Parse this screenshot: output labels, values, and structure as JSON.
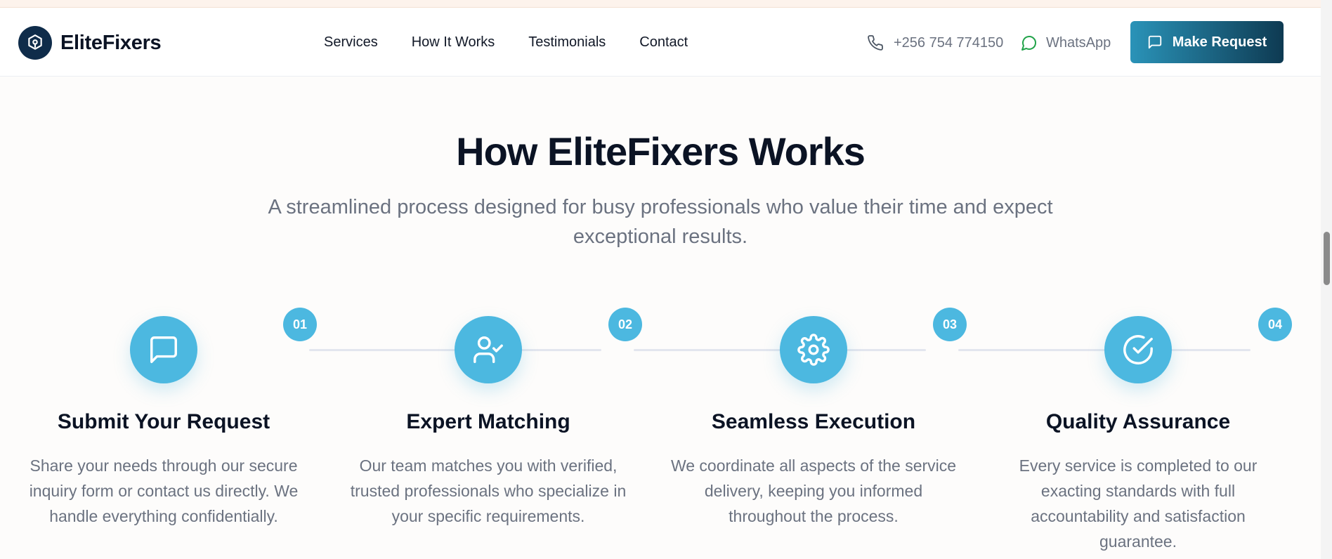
{
  "brand": {
    "name": "EliteFixers"
  },
  "nav": {
    "items": [
      "Services",
      "How It Works",
      "Testimonials",
      "Contact"
    ]
  },
  "contact": {
    "phone": "+256 754 774150",
    "whatsapp": "WhatsApp"
  },
  "cta": {
    "label": "Make Request"
  },
  "section": {
    "title": "How EliteFixers Works",
    "subtitle_line1": "A streamlined process designed for busy professionals who value their time and expect",
    "subtitle_line2": "exceptional results."
  },
  "steps": [
    {
      "number": "01",
      "icon": "message-square-icon",
      "title": "Submit Your Request",
      "description": "Share your needs through our secure inquiry form or contact us directly. We handle everything confidentially."
    },
    {
      "number": "02",
      "icon": "user-check-icon",
      "title": "Expert Matching",
      "description": "Our team matches you with verified, trusted professionals who specialize in your specific requirements."
    },
    {
      "number": "03",
      "icon": "settings-gear-icon",
      "title": "Seamless Execution",
      "description": "We coordinate all aspects of the service delivery, keeping you informed throughout the process."
    },
    {
      "number": "04",
      "icon": "check-circle-icon",
      "title": "Quality Assurance",
      "description": "Every service is completed to our exacting standards with full accountability and satisfaction guarantee."
    }
  ],
  "colors": {
    "accent": "#4cb8e0",
    "brand_dark": "#0f2c4a",
    "cta_gradient_start": "#2a93b8",
    "cta_gradient_end": "#0e3a52",
    "whatsapp_green": "#22a34a"
  }
}
